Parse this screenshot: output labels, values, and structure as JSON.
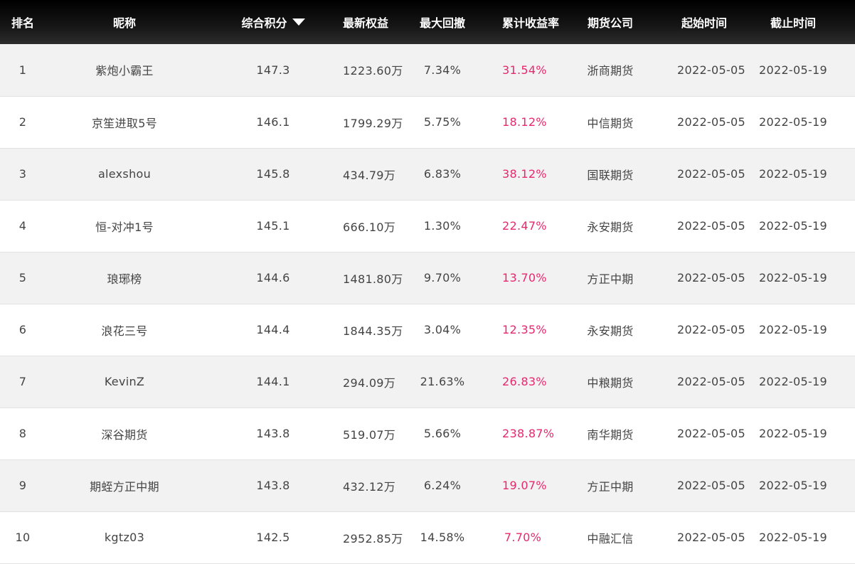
{
  "header": {
    "rank": "排名",
    "nickname": "昵称",
    "score": "综合积分",
    "equity": "最新权益",
    "drawdown": "最大回撤",
    "return": "累计收益率",
    "firm": "期货公司",
    "start": "起始时间",
    "end": "截止时间",
    "sort_icon": "caret-down-icon"
  },
  "colors": {
    "header_bg": "#000000",
    "return_text": "#e6286e",
    "row_alt": "#f2f2f2"
  },
  "rows": [
    {
      "rank": "1",
      "nickname": "紫炮小霸王",
      "score": "147.3",
      "equity": "1223.60万",
      "drawdown": "7.34%",
      "return": "31.54%",
      "firm": "浙商期货",
      "start": "2022-05-05",
      "end": "2022-05-19"
    },
    {
      "rank": "2",
      "nickname": "京笙进取5号",
      "score": "146.1",
      "equity": "1799.29万",
      "drawdown": "5.75%",
      "return": "18.12%",
      "firm": "中信期货",
      "start": "2022-05-05",
      "end": "2022-05-19"
    },
    {
      "rank": "3",
      "nickname": "alexshou",
      "score": "145.8",
      "equity": "434.79万",
      "drawdown": "6.83%",
      "return": "38.12%",
      "firm": "国联期货",
      "start": "2022-05-05",
      "end": "2022-05-19"
    },
    {
      "rank": "4",
      "nickname": "恒-对冲1号",
      "score": "145.1",
      "equity": "666.10万",
      "drawdown": "1.30%",
      "return": "22.47%",
      "firm": "永安期货",
      "start": "2022-05-05",
      "end": "2022-05-19"
    },
    {
      "rank": "5",
      "nickname": "琅琊榜",
      "score": "144.6",
      "equity": "1481.80万",
      "drawdown": "9.70%",
      "return": "13.70%",
      "firm": "方正中期",
      "start": "2022-05-05",
      "end": "2022-05-19"
    },
    {
      "rank": "6",
      "nickname": "浪花三号",
      "score": "144.4",
      "equity": "1844.35万",
      "drawdown": "3.04%",
      "return": "12.35%",
      "firm": "永安期货",
      "start": "2022-05-05",
      "end": "2022-05-19"
    },
    {
      "rank": "7",
      "nickname": "KevinZ",
      "score": "144.1",
      "equity": "294.09万",
      "drawdown": "21.63%",
      "return": "26.83%",
      "firm": "中粮期货",
      "start": "2022-05-05",
      "end": "2022-05-19"
    },
    {
      "rank": "8",
      "nickname": "深谷期货",
      "score": "143.8",
      "equity": "519.07万",
      "drawdown": "5.66%",
      "return": "238.87%",
      "firm": "南华期货",
      "start": "2022-05-05",
      "end": "2022-05-19"
    },
    {
      "rank": "9",
      "nickname": "期蛭方正中期",
      "score": "143.8",
      "equity": "432.12万",
      "drawdown": "6.24%",
      "return": "19.07%",
      "firm": "方正中期",
      "start": "2022-05-05",
      "end": "2022-05-19"
    },
    {
      "rank": "10",
      "nickname": "kgtz03",
      "score": "142.5",
      "equity": "2952.85万",
      "drawdown": "14.58%",
      "return": "7.70%",
      "firm": "中融汇信",
      "start": "2022-05-05",
      "end": "2022-05-19"
    }
  ]
}
